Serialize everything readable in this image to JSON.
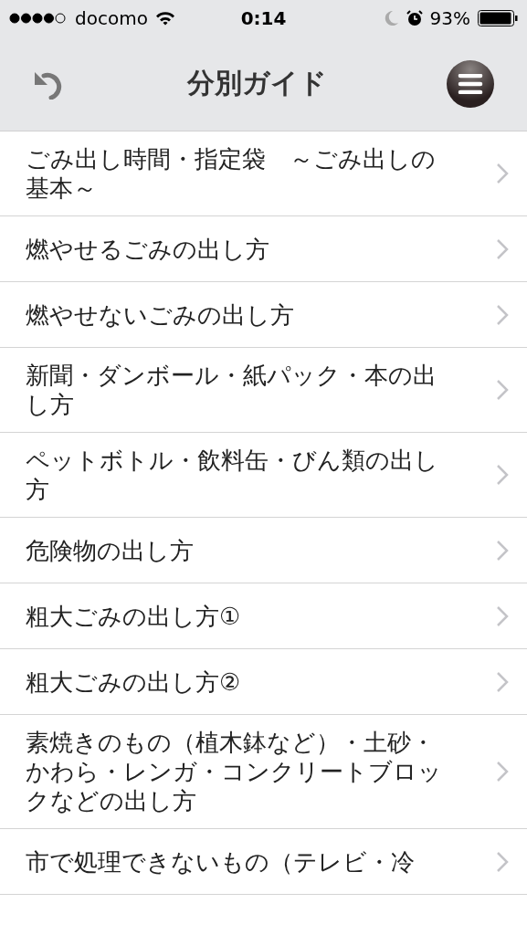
{
  "status_bar": {
    "carrier": "docomo",
    "time": "0:14",
    "battery": "93%"
  },
  "nav_bar": {
    "title": "分別ガイド"
  },
  "items": [
    {
      "label": "ごみ出し時間・指定袋　～ごみ出しの基本～"
    },
    {
      "label": "燃やせるごみの出し方"
    },
    {
      "label": "燃やせないごみの出し方"
    },
    {
      "label": "新聞・ダンボール・紙パック・本の出し方"
    },
    {
      "label": "ペットボトル・飲料缶・びん類の出し方"
    },
    {
      "label": "危険物の出し方"
    },
    {
      "label": "粗大ごみの出し方①"
    },
    {
      "label": "粗大ごみの出し方②"
    },
    {
      "label": "素焼きのもの（植木鉢など）・土砂・かわら・レンガ・コンクリートブロックなどの出し方"
    },
    {
      "label": "市で処理できないもの（テレビ・冷"
    }
  ]
}
